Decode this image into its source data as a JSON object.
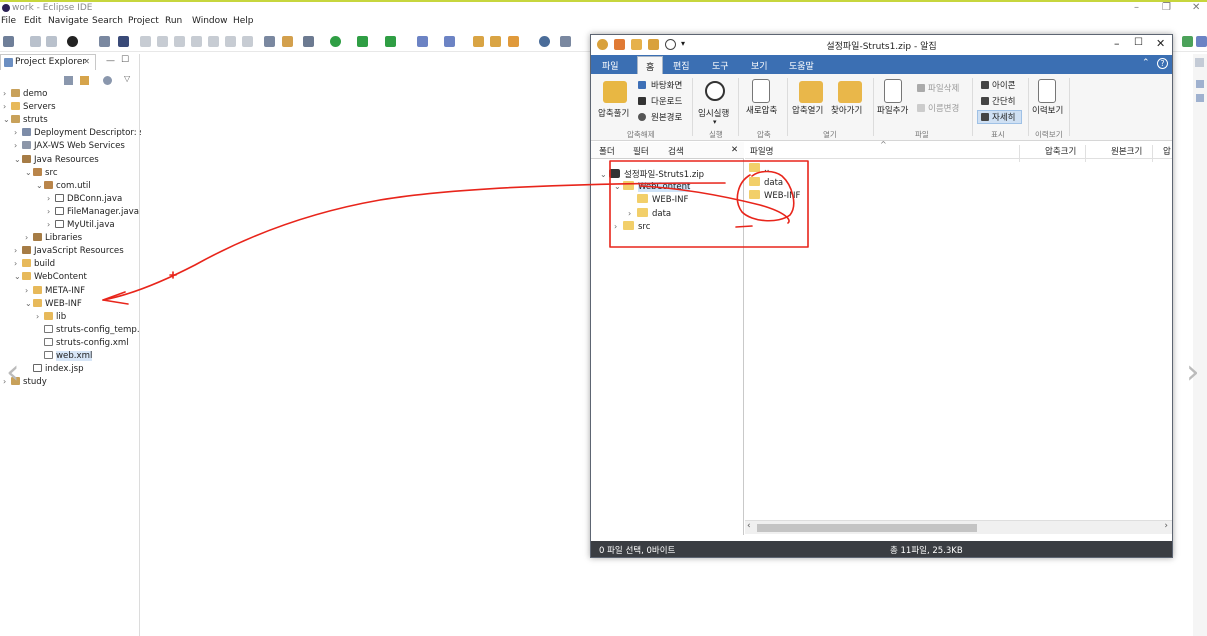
{
  "eclipse": {
    "window_title": "work - Eclipse IDE",
    "menu": [
      "File",
      "Edit",
      "Navigate",
      "Search",
      "Project",
      "Run",
      "Window",
      "Help"
    ],
    "explorer_tab": "Project Explorer",
    "tree": [
      {
        "label": "demo",
        "depth": 0,
        "expander": ">",
        "icon": "project-icon"
      },
      {
        "label": "Servers",
        "depth": 0,
        "expander": ">",
        "icon": "folder-icon"
      },
      {
        "label": "struts",
        "depth": 0,
        "expander": "v",
        "icon": "project-icon"
      },
      {
        "label": "Deployment Descriptor: s",
        "depth": 1,
        "expander": ">",
        "icon": "descriptor-icon"
      },
      {
        "label": "JAX-WS Web Services",
        "depth": 1,
        "expander": ">",
        "icon": "webservice-icon"
      },
      {
        "label": "Java Resources",
        "depth": 1,
        "expander": "v",
        "icon": "java-resources-icon"
      },
      {
        "label": "src",
        "depth": 2,
        "expander": "v",
        "icon": "source-folder-icon"
      },
      {
        "label": "com.util",
        "depth": 3,
        "expander": "v",
        "icon": "package-icon"
      },
      {
        "label": "DBConn.java",
        "depth": 4,
        "expander": ">",
        "icon": "java-file-icon"
      },
      {
        "label": "FileManager.java",
        "depth": 4,
        "expander": ">",
        "icon": "java-file-icon"
      },
      {
        "label": "MyUtil.java",
        "depth": 4,
        "expander": ">",
        "icon": "java-file-icon"
      },
      {
        "label": "Libraries",
        "depth": 2,
        "expander": ">",
        "icon": "library-icon"
      },
      {
        "label": "JavaScript Resources",
        "depth": 1,
        "expander": ">",
        "icon": "javascript-icon"
      },
      {
        "label": "build",
        "depth": 1,
        "expander": ">",
        "icon": "folder-icon"
      },
      {
        "label": "WebContent",
        "depth": 1,
        "expander": "v",
        "icon": "folder-icon"
      },
      {
        "label": "META-INF",
        "depth": 2,
        "expander": ">",
        "icon": "folder-icon"
      },
      {
        "label": "WEB-INF",
        "depth": 2,
        "expander": "v",
        "icon": "folder-icon"
      },
      {
        "label": "lib",
        "depth": 3,
        "expander": ">",
        "icon": "folder-icon"
      },
      {
        "label": "struts-config_temp.",
        "depth": 3,
        "expander": "",
        "icon": "xml-file-icon"
      },
      {
        "label": "struts-config.xml",
        "depth": 3,
        "expander": "",
        "icon": "xml-file-icon"
      },
      {
        "label": "web.xml",
        "depth": 3,
        "expander": "",
        "icon": "xml-file-icon",
        "selected": true
      },
      {
        "label": "index.jsp",
        "depth": 2,
        "expander": "",
        "icon": "jsp-file-icon"
      },
      {
        "label": "study",
        "depth": 0,
        "expander": ">",
        "icon": "project-icon"
      }
    ]
  },
  "zip": {
    "title": "설정파일-Struts1.zip - 알집",
    "tabs": [
      "파일",
      "홈",
      "편집",
      "도구",
      "보기",
      "도움말"
    ],
    "active_tab": "홈",
    "ribbon": {
      "extract": "압축풀기",
      "to_desktop": "바탕화면",
      "to_downloads": "다운로드",
      "to_source": "원본경로",
      "group_extract": "압축해제",
      "temp_run": "임시실행",
      "group_run": "실행",
      "new_zip": "새로압축",
      "group_zip": "압축",
      "open_zip": "압축열기",
      "find": "찾아가기",
      "group_open": "열기",
      "add_file": "파일추가",
      "delete_file": "파일삭제",
      "rename": "이름변경",
      "group_file": "파일",
      "view_icon": "아이콘",
      "view_simple": "간단히",
      "view_detail": "자세히",
      "group_view": "표시",
      "history": "이력보기",
      "group_history": "이력보기"
    },
    "left_tabs": [
      "폴더",
      "필터",
      "검색"
    ],
    "folder_tree": [
      {
        "label": "설정파일-Struts1.zip",
        "level": 0,
        "expander": "v",
        "icon": "zip-icon"
      },
      {
        "label": "WebContent",
        "level": 1,
        "expander": "v",
        "icon": "folder-icon",
        "selected": true
      },
      {
        "label": "WEB-INF",
        "level": 2,
        "expander": "",
        "icon": "folder-icon"
      },
      {
        "label": "data",
        "level": 2,
        "expander": ">",
        "icon": "folder-icon"
      },
      {
        "label": "src",
        "level": 1,
        "expander": ">",
        "icon": "folder-icon"
      }
    ],
    "columns": [
      "파일명",
      "압축크기",
      "원본크기",
      "압"
    ],
    "files": [
      "..",
      "data",
      "WEB-INF"
    ],
    "status_left": "0 파일 선택, 0바이트",
    "status_right": "총 11파일, 25.3KB"
  },
  "annotation_color": "#e8251b"
}
